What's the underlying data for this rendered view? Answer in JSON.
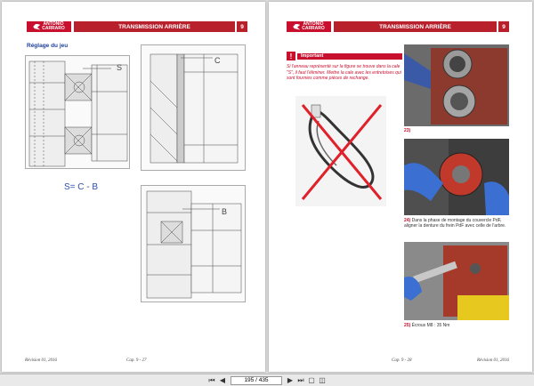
{
  "left_page": {
    "header": {
      "logo_line1": "ANTONIO",
      "logo_line2": "CARRARO",
      "title": "TRANSMISSION ARRIÈRE",
      "number": "9"
    },
    "section_title": "Réglage du jeu",
    "labels": {
      "s": "S",
      "c": "C",
      "b": "B"
    },
    "formula": "S= C - B",
    "footer_left": "Révision 01, 2016",
    "footer_right": "Cap. 9 - 27"
  },
  "right_page": {
    "header": {
      "logo_line1": "ANTONIO",
      "logo_line2": "CARRARO",
      "title": "TRANSMISSION ARRIÈRE",
      "number": "9"
    },
    "important": {
      "icon": "!",
      "label": "Important",
      "text": "Si l'anneau représenté sur la figure se trouve dans la cale \"S\", il faut l'éliminer. Mettre la cale avec les entretoises qui sont fournies comme pièces de rechange."
    },
    "captions": {
      "c23_num": "23)",
      "c24_num": "24)",
      "c24_text": "Dans la phase de montage du couvercle PdF, aligner la denture du frein PdF avec celle de l'arbre.",
      "c25_num": "25)",
      "c25_text": "Écrous M8 : 35 Nm"
    },
    "footer_left": "Cap. 9 - 28",
    "footer_right": "Révision 01, 2016"
  },
  "toolbar": {
    "page_indicator": "195 / 435"
  }
}
